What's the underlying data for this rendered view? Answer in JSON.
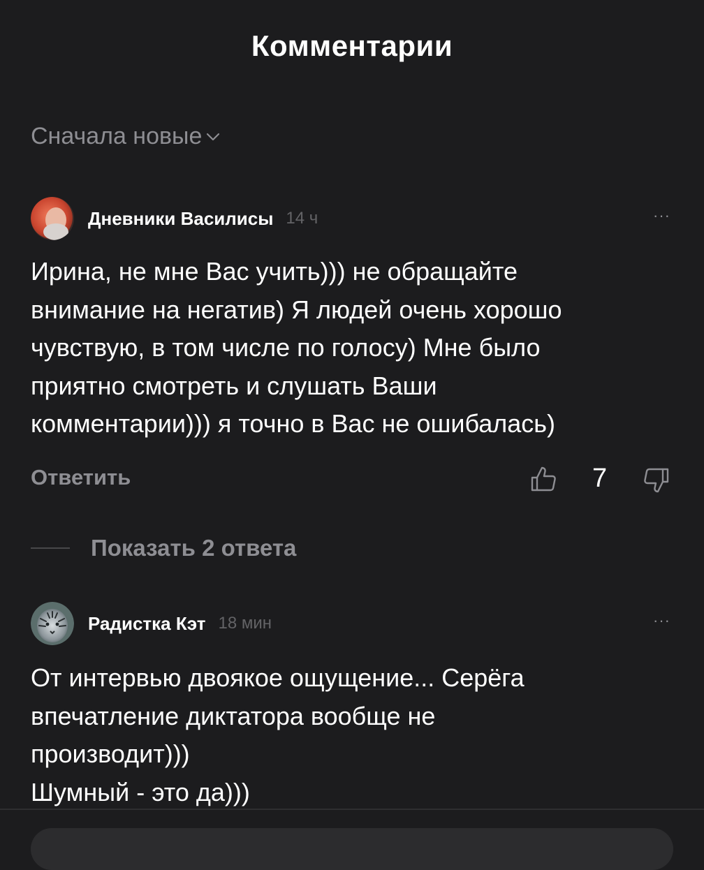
{
  "header": {
    "title": "Комментарии"
  },
  "sort": {
    "label": "Сначала новые",
    "icon": "chevron-down-icon"
  },
  "comments": [
    {
      "author": "Дневники Василисы",
      "time": "14 ч",
      "more": "···",
      "lines": [
        "Ирина, не мне Вас учить))) не обращайте",
        "внимание на негатив) Я людей очень хорошо",
        "чувствую, в том числе по голосу) Мне было",
        "приятно смотреть и слушать Ваши",
        "комментарии))) я точно в Вас не ошибалась)"
      ],
      "reply_label": "Ответить",
      "likes": "7",
      "show_replies": "Показать 2 ответа"
    },
    {
      "author": "Радистка Кэт",
      "time": "18 мин",
      "more": "···",
      "lines": [
        "От интервью двоякое ощущение... Серёга",
        "впечатление диктатора вообще не",
        "производит)))",
        "Шумный - это да)))"
      ]
    }
  ],
  "colors": {
    "background": "#1c1c1e",
    "text_primary": "#ffffff",
    "text_secondary": "#8e8e93",
    "text_tertiary": "#636366"
  }
}
